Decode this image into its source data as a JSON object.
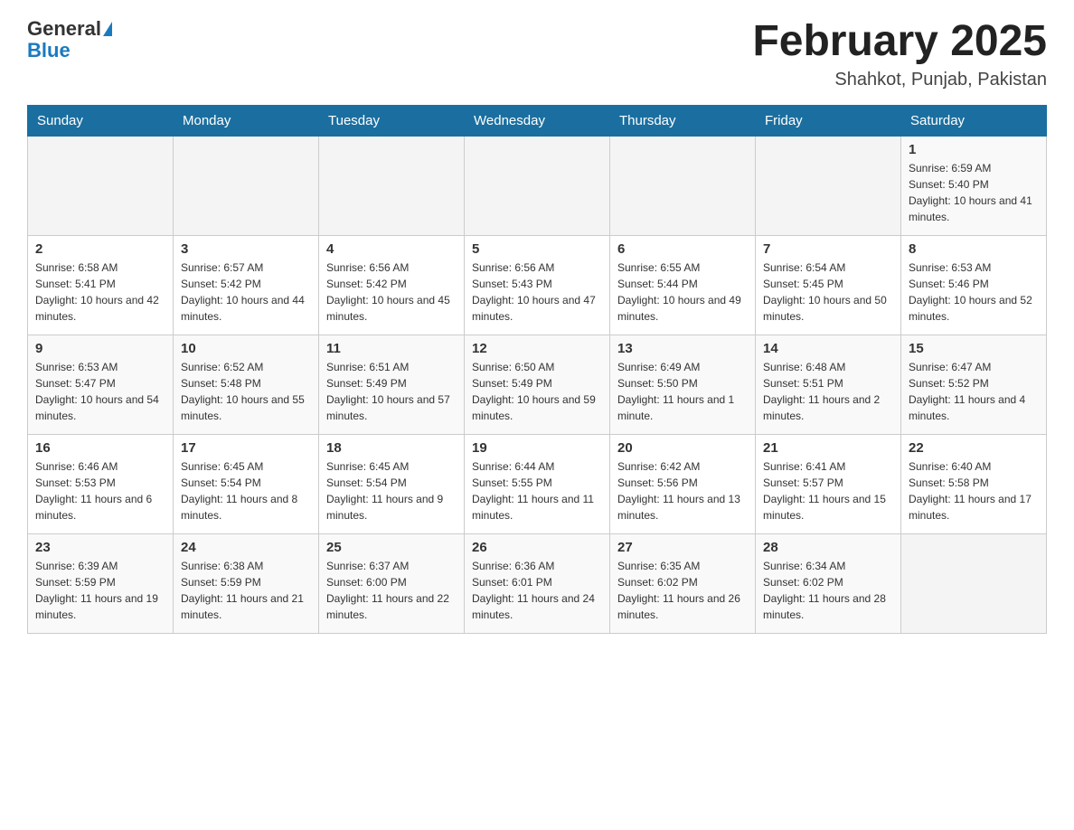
{
  "header": {
    "logo_general": "General",
    "logo_blue": "Blue",
    "month_year": "February 2025",
    "location": "Shahkot, Punjab, Pakistan"
  },
  "days_of_week": [
    "Sunday",
    "Monday",
    "Tuesday",
    "Wednesday",
    "Thursday",
    "Friday",
    "Saturday"
  ],
  "weeks": [
    [
      {
        "day": "",
        "info": ""
      },
      {
        "day": "",
        "info": ""
      },
      {
        "day": "",
        "info": ""
      },
      {
        "day": "",
        "info": ""
      },
      {
        "day": "",
        "info": ""
      },
      {
        "day": "",
        "info": ""
      },
      {
        "day": "1",
        "info": "Sunrise: 6:59 AM\nSunset: 5:40 PM\nDaylight: 10 hours and 41 minutes."
      }
    ],
    [
      {
        "day": "2",
        "info": "Sunrise: 6:58 AM\nSunset: 5:41 PM\nDaylight: 10 hours and 42 minutes."
      },
      {
        "day": "3",
        "info": "Sunrise: 6:57 AM\nSunset: 5:42 PM\nDaylight: 10 hours and 44 minutes."
      },
      {
        "day": "4",
        "info": "Sunrise: 6:56 AM\nSunset: 5:42 PM\nDaylight: 10 hours and 45 minutes."
      },
      {
        "day": "5",
        "info": "Sunrise: 6:56 AM\nSunset: 5:43 PM\nDaylight: 10 hours and 47 minutes."
      },
      {
        "day": "6",
        "info": "Sunrise: 6:55 AM\nSunset: 5:44 PM\nDaylight: 10 hours and 49 minutes."
      },
      {
        "day": "7",
        "info": "Sunrise: 6:54 AM\nSunset: 5:45 PM\nDaylight: 10 hours and 50 minutes."
      },
      {
        "day": "8",
        "info": "Sunrise: 6:53 AM\nSunset: 5:46 PM\nDaylight: 10 hours and 52 minutes."
      }
    ],
    [
      {
        "day": "9",
        "info": "Sunrise: 6:53 AM\nSunset: 5:47 PM\nDaylight: 10 hours and 54 minutes."
      },
      {
        "day": "10",
        "info": "Sunrise: 6:52 AM\nSunset: 5:48 PM\nDaylight: 10 hours and 55 minutes."
      },
      {
        "day": "11",
        "info": "Sunrise: 6:51 AM\nSunset: 5:49 PM\nDaylight: 10 hours and 57 minutes."
      },
      {
        "day": "12",
        "info": "Sunrise: 6:50 AM\nSunset: 5:49 PM\nDaylight: 10 hours and 59 minutes."
      },
      {
        "day": "13",
        "info": "Sunrise: 6:49 AM\nSunset: 5:50 PM\nDaylight: 11 hours and 1 minute."
      },
      {
        "day": "14",
        "info": "Sunrise: 6:48 AM\nSunset: 5:51 PM\nDaylight: 11 hours and 2 minutes."
      },
      {
        "day": "15",
        "info": "Sunrise: 6:47 AM\nSunset: 5:52 PM\nDaylight: 11 hours and 4 minutes."
      }
    ],
    [
      {
        "day": "16",
        "info": "Sunrise: 6:46 AM\nSunset: 5:53 PM\nDaylight: 11 hours and 6 minutes."
      },
      {
        "day": "17",
        "info": "Sunrise: 6:45 AM\nSunset: 5:54 PM\nDaylight: 11 hours and 8 minutes."
      },
      {
        "day": "18",
        "info": "Sunrise: 6:45 AM\nSunset: 5:54 PM\nDaylight: 11 hours and 9 minutes."
      },
      {
        "day": "19",
        "info": "Sunrise: 6:44 AM\nSunset: 5:55 PM\nDaylight: 11 hours and 11 minutes."
      },
      {
        "day": "20",
        "info": "Sunrise: 6:42 AM\nSunset: 5:56 PM\nDaylight: 11 hours and 13 minutes."
      },
      {
        "day": "21",
        "info": "Sunrise: 6:41 AM\nSunset: 5:57 PM\nDaylight: 11 hours and 15 minutes."
      },
      {
        "day": "22",
        "info": "Sunrise: 6:40 AM\nSunset: 5:58 PM\nDaylight: 11 hours and 17 minutes."
      }
    ],
    [
      {
        "day": "23",
        "info": "Sunrise: 6:39 AM\nSunset: 5:59 PM\nDaylight: 11 hours and 19 minutes."
      },
      {
        "day": "24",
        "info": "Sunrise: 6:38 AM\nSunset: 5:59 PM\nDaylight: 11 hours and 21 minutes."
      },
      {
        "day": "25",
        "info": "Sunrise: 6:37 AM\nSunset: 6:00 PM\nDaylight: 11 hours and 22 minutes."
      },
      {
        "day": "26",
        "info": "Sunrise: 6:36 AM\nSunset: 6:01 PM\nDaylight: 11 hours and 24 minutes."
      },
      {
        "day": "27",
        "info": "Sunrise: 6:35 AM\nSunset: 6:02 PM\nDaylight: 11 hours and 26 minutes."
      },
      {
        "day": "28",
        "info": "Sunrise: 6:34 AM\nSunset: 6:02 PM\nDaylight: 11 hours and 28 minutes."
      },
      {
        "day": "",
        "info": ""
      }
    ]
  ]
}
